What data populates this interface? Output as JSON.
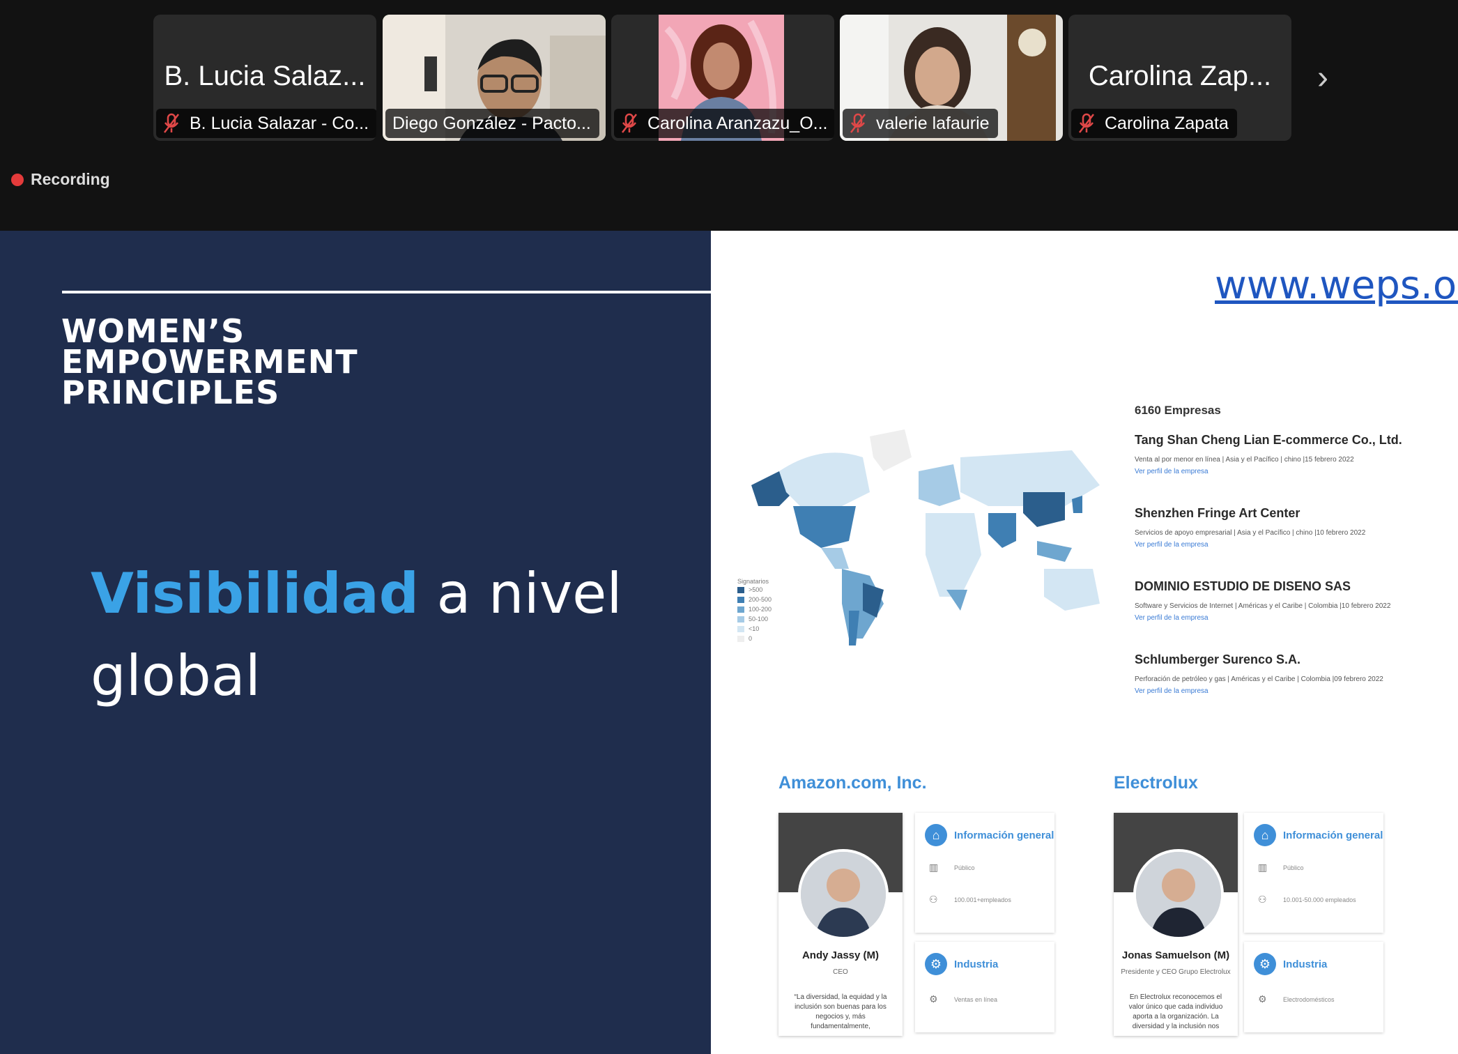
{
  "participants": [
    {
      "display_name": "B. Lucia Salaz...",
      "label": "B. Lucia Salazar - Co...",
      "muted": true,
      "video": false
    },
    {
      "display_name": "",
      "label": "Diego González - Pacto...",
      "muted": false,
      "video": true,
      "active_speaker": true
    },
    {
      "display_name": "",
      "label": "Carolina Aranzazu_O...",
      "muted": true,
      "video": true
    },
    {
      "display_name": "",
      "label": "valerie lafaurie",
      "muted": true,
      "video": true
    },
    {
      "display_name": "Carolina Zap...",
      "label": "Carolina Zapata",
      "muted": true,
      "video": false
    }
  ],
  "recording": {
    "label": "Recording"
  },
  "slide": {
    "logo": [
      "WOMEN’S",
      "EMPOWERMENT",
      "PRINCIPLES"
    ],
    "headline_highlight": "Visibilidad",
    "headline_rest": "a nivel global",
    "url": "www.weps.or",
    "map_legend": {
      "title": "Signatarios",
      "items": [
        ">500",
        "200-500",
        "100-200",
        "50-100",
        "<10",
        "0"
      ],
      "colors": [
        "#2b5e8c",
        "#3f7fb3",
        "#6ea6cf",
        "#a6cbe6",
        "#d3e6f3",
        "#eeeeee"
      ]
    },
    "company_count": "6160 Empresas",
    "companies": [
      {
        "name": "Tang Shan Cheng Lian E-commerce Co., Ltd.",
        "meta": "Venta al por menor en línea | Asia y el Pacífico | chino |15 febrero 2022",
        "link": "Ver perfil de la empresa"
      },
      {
        "name": "Shenzhen Fringe Art Center",
        "meta": "Servicios de apoyo empresarial | Asia y el Pacífico | chino |10 febrero 2022",
        "link": "Ver perfil de la empresa"
      },
      {
        "name": "DOMINIO ESTUDIO DE DISENO SAS",
        "meta": "Software y Servicios de Internet | Américas y el Caribe | Colombia |10 febrero 2022",
        "link": "Ver perfil de la empresa"
      },
      {
        "name": "Schlumberger Surenco S.A.",
        "meta": "Perforación de petróleo y gas | Américas y el Caribe | Colombia |09 febrero 2022",
        "link": "Ver perfil de la empresa"
      }
    ],
    "profiles": [
      {
        "company": "Amazon.com, Inc.",
        "person": "Andy Jassy (M)",
        "role": "CEO",
        "quote": "“La diversidad, la equidad y la inclusión son buenas para los negocios y, más fundamentalmente,",
        "info_title": "Información general",
        "type": "Público",
        "employees": "100.001+empleados",
        "industry_title": "Industria",
        "industry": "Ventas en línea"
      },
      {
        "company": "Electrolux",
        "person": "Jonas Samuelson (M)",
        "role": "Presidente y CEO Grupo Electrolux",
        "quote": "En Electrolux reconocemos el valor único que cada individuo aporta a la organización. La diversidad y la inclusión nos",
        "info_title": "Información general",
        "type": "Público",
        "employees": "10.001-50.000 empleados",
        "industry_title": "Industria",
        "industry": "Electrodomésticos"
      }
    ]
  }
}
